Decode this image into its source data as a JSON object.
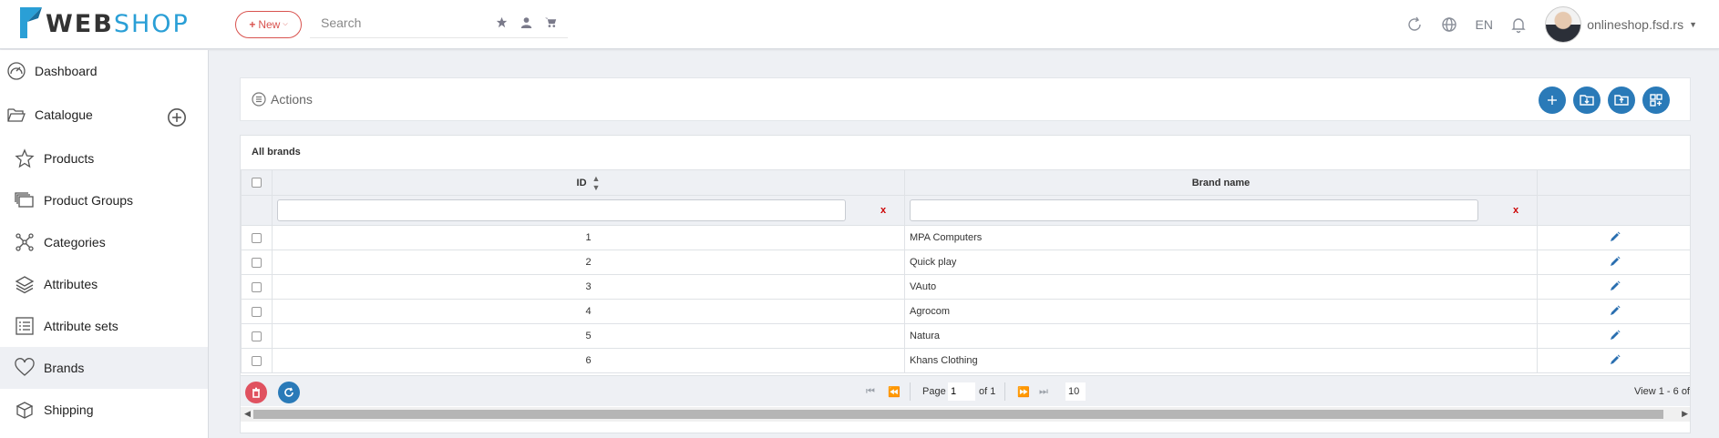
{
  "app": {
    "logo_web": "WEB",
    "logo_shop": "SHOP",
    "new_button": "New",
    "search_placeholder": "Search",
    "language": "EN",
    "user": "onlineshop.fsd.rs"
  },
  "sidebar": {
    "dashboard": "Dashboard",
    "catalogue": "Catalogue",
    "items": [
      "Products",
      "Product Groups",
      "Categories",
      "Attributes",
      "Attribute sets",
      "Brands",
      "Shipping"
    ],
    "active": "Brands"
  },
  "actions": {
    "title": "Actions"
  },
  "grid": {
    "caption": "All brands",
    "columns": {
      "id": "ID",
      "name": "Brand name"
    },
    "filter_clear": "x",
    "rows": [
      {
        "id": "1",
        "name": "MPA Computers"
      },
      {
        "id": "2",
        "name": "Quick play"
      },
      {
        "id": "3",
        "name": "VAuto"
      },
      {
        "id": "4",
        "name": "Agrocom"
      },
      {
        "id": "5",
        "name": "Natura"
      },
      {
        "id": "6",
        "name": "Khans Clothing"
      }
    ]
  },
  "pager": {
    "page_label": "Page",
    "page_value": "1",
    "of_label": "of 1",
    "page_size": "10",
    "view_text": "View 1 - 6 of"
  },
  "colors": {
    "accent": "#2a7ab8",
    "danger": "#e05260",
    "logo_blue": "#2a9fd6"
  }
}
